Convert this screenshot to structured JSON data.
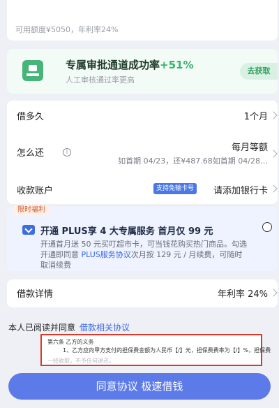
{
  "top": {
    "available_credit": "可用额度¥5050，年利率24%"
  },
  "approval": {
    "title": "专属审批通道成功率",
    "rate": "+51%",
    "subtitle": "人工审核通过率更高",
    "button": "去获取"
  },
  "form": {
    "term_label": "借多久",
    "term_value": "1个月",
    "repay_label": "怎么还",
    "repay_value": "每月等额",
    "repay_detail": "如首期 04/23，还¥487.68如首期 04/28…",
    "account_label": "收款账户",
    "account_badge": "支持免输卡号",
    "account_value": "请添加银行卡"
  },
  "benefit": {
    "badge": "限时福利",
    "title": "开通 PLUS享 4 大专属服务 首月仅 99 元",
    "desc_1": "开通首月送 50 元买叮超市卡，可当钱花购买热门商品。勾选开通即同意 ",
    "desc_link": "PLUS服务协议",
    "desc_2": "次月按 129 元 / 月续费，可随时取消续费"
  },
  "details": {
    "label": "借款详情",
    "value": "年利率 24%"
  },
  "agreement": {
    "prefix": "本人已阅读并同意",
    "link": "借款相关协议",
    "doc_clause": "第六条  乙方的义务",
    "doc_text": "1、乙方应向甲方支付的担保费金额为人民币【/】元，担保费费率为【/】%，担保费",
    "doc_faint": "一经收取，不予任何退还。"
  },
  "action": {
    "button": "同意协议 极速借钱"
  }
}
